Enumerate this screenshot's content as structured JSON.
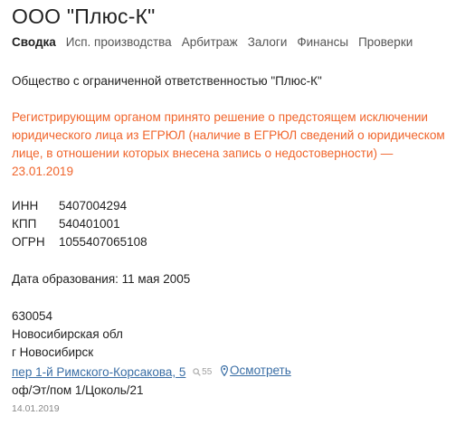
{
  "header": {
    "title": "ООО \"Плюс-К\""
  },
  "tabs": [
    {
      "label": "Сводка",
      "active": true
    },
    {
      "label": "Исп. производства",
      "active": false
    },
    {
      "label": "Арбитраж",
      "active": false
    },
    {
      "label": "Залоги",
      "active": false
    },
    {
      "label": "Финансы",
      "active": false
    },
    {
      "label": "Проверки",
      "active": false
    }
  ],
  "company": {
    "full_name": "Общество с ограниченной ответственностью \"Плюс-К\"",
    "warning": "Регистрирующим органом принято решение о предстоящем исключении юридического лица из ЕГРЮЛ (наличие в ЕГРЮЛ сведений о юридическом лице, в отношении которых внесена запись о недостоверности) — 23.01.2019",
    "codes": [
      {
        "label": "ИНН",
        "value": "5407004294"
      },
      {
        "label": "КПП",
        "value": "540401001"
      },
      {
        "label": "ОГРН",
        "value": "1055407065108"
      }
    ],
    "founded": "Дата образования: 11 мая 2005"
  },
  "address": {
    "postcode": "630054",
    "region": "Новосибирская обл",
    "city": "г Новосибирск",
    "street_link": "пер 1-й Римского-Корсакова, 5",
    "views_count": "55",
    "view_link": "Осмотреть",
    "office": "оф/Эт/пом 1/Цоколь/21",
    "date": "14.01.2019"
  },
  "colors": {
    "warning": "#f0652c",
    "link": "#3a6ea5",
    "muted": "#888888"
  },
  "icons": {
    "views": "magnifier-icon",
    "location": "map-pin-icon"
  }
}
